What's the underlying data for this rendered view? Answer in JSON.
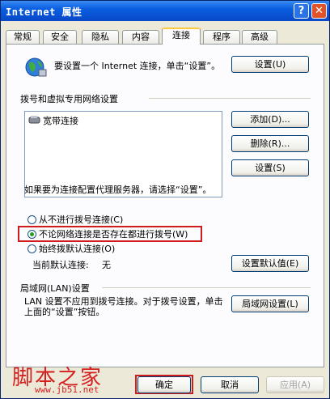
{
  "window": {
    "title": "Internet 属性",
    "help_glyph": "?",
    "close_glyph": "✕"
  },
  "tabs": [
    "常规",
    "安全",
    "隐私",
    "内容",
    "连接",
    "程序",
    "高级"
  ],
  "active_tab": "连接",
  "setup": {
    "text": "要设置一个 Internet 连接，单击“设置”。",
    "button": "设置(U)"
  },
  "dialup_group": {
    "title": "拨号和虚拟专用网络设置",
    "connections": [
      "宽带连接"
    ],
    "add_button": "添加(D)...",
    "remove_button": "删除(R)...",
    "settings_button": "设置(S)"
  },
  "proxy_text": "如果要为连接配置代理服务器，请选择“设置”。",
  "options": [
    {
      "label": "从不进行拨号连接(C)",
      "selected": false
    },
    {
      "label": "不论网络连接是否存在都进行拨号(W)",
      "selected": true
    },
    {
      "label": "始终拨默认连接(O)",
      "selected": false
    }
  ],
  "default_connection": {
    "label": "当前默认连接:",
    "value": "无",
    "button": "设置默认值(E)"
  },
  "lan_group": {
    "title": "局域网(LAN)设置",
    "text": "LAN 设置不应用到拨号连接。对于拨号设置，单击上面的“设置”按钮。",
    "button": "局域网设置(L)"
  },
  "footer": {
    "ok": "确定",
    "cancel": "取消",
    "apply": "应用(A)"
  },
  "watermark": {
    "text": "脚本之家",
    "url": "www.jb51.net"
  },
  "colors": {
    "highlight": "#d01c1c",
    "titlebar": "#0a5ee0"
  }
}
